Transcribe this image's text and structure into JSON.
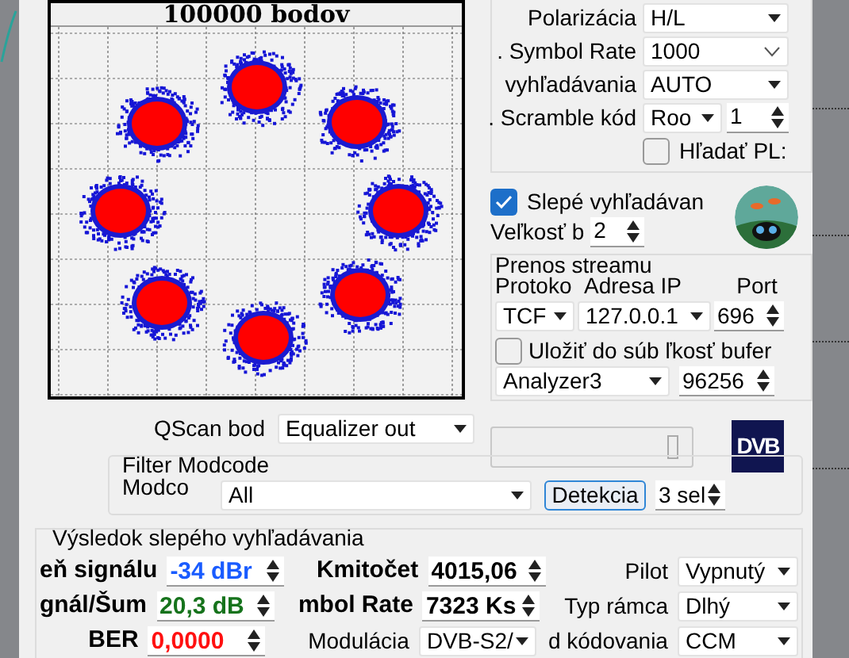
{
  "constellation": {
    "title": "100000 bodov"
  },
  "tuning": {
    "rows": [
      {
        "label": "Polarizácia",
        "kind": "dropdown",
        "value": "H/L"
      },
      {
        "label": ". Symbol Rate",
        "kind": "combo",
        "value": "1000"
      },
      {
        "label": "vyhľadávania",
        "kind": "dropdown",
        "value": "AUTO"
      },
      {
        "label": ". Scramble kód",
        "kind": "dropdown_spin",
        "value": "Roo",
        "spin": "1"
      }
    ],
    "search_pls": {
      "label": "Hľadať PL:",
      "checked": false
    }
  },
  "blind_search": {
    "label": "Slepé vyhľadávan",
    "checked": true,
    "step_label": "Veľkosť b",
    "step": "2"
  },
  "stream": {
    "title": "Prenos streamu",
    "columns": [
      "Protoko",
      "Adresa IP",
      "Port"
    ],
    "protocol": "TCF",
    "ip": "127.0.0.1",
    "port": "696",
    "save": {
      "label": "Uložiť do súb",
      "checked": false
    },
    "buffer_label": "ľkosť bufer",
    "target": "Analyzer3",
    "buffer": "96256"
  },
  "iqscan": {
    "label": "QScan bod",
    "value": "Equalizer out"
  },
  "dvb_logo": "DVB",
  "filter": {
    "title": "Filter Modcode",
    "label": "Modco",
    "value": "All",
    "button": "Detekcia",
    "spin": "3 sel"
  },
  "result": {
    "title": "Výsledok slepého vyhľadávania",
    "rows": [
      {
        "cells": [
          {
            "label": "eň signálu",
            "strong": true,
            "kind": "spin",
            "value": "-34 dBr",
            "color": "#1a5cff"
          },
          {
            "label": "Kmitočet",
            "strong": true,
            "kind": "spin",
            "value": "4015,06"
          },
          {
            "label": "Pilot",
            "strong": false,
            "kind": "dropdown",
            "value": "Vypnutý"
          }
        ]
      },
      {
        "cells": [
          {
            "label": "gnál/Šum",
            "strong": true,
            "kind": "spin",
            "value": "20,3 dB",
            "color": "#16731c"
          },
          {
            "label": "mbol Rate",
            "strong": true,
            "kind": "spin",
            "value": "7323 Ks"
          },
          {
            "label": "Typ rámca",
            "strong": false,
            "kind": "dropdown",
            "value": "Dlhý"
          }
        ]
      },
      {
        "cells": [
          {
            "label": "BER",
            "strong": true,
            "kind": "spin",
            "value": "0,0000",
            "color": "#ff1010"
          },
          {
            "label": "Modulácia",
            "strong": false,
            "kind": "dropdown",
            "value": "DVB-S2/"
          },
          {
            "label": "d kódovania",
            "strong": false,
            "kind": "dropdown",
            "value": "CCM"
          }
        ]
      }
    ]
  }
}
